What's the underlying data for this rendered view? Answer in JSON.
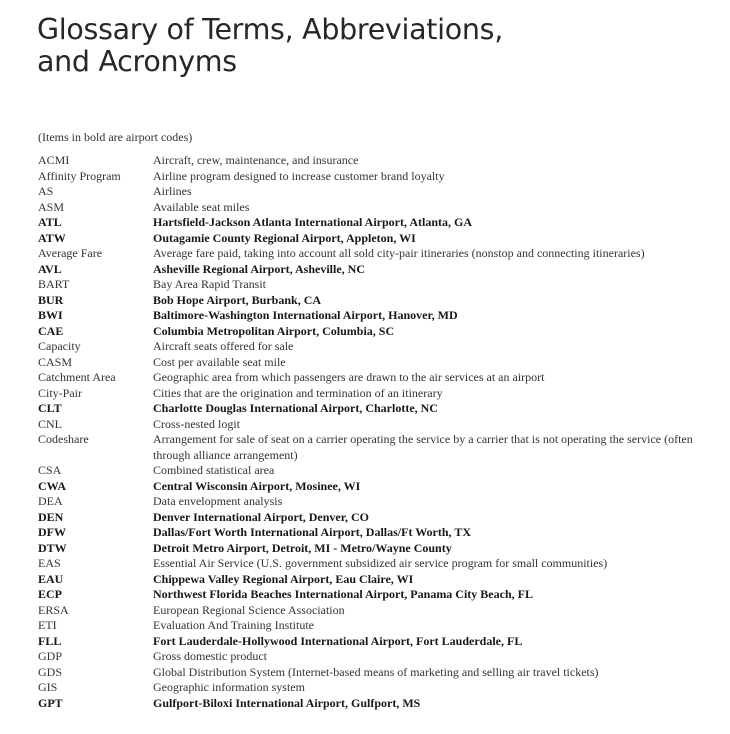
{
  "title_line1": "Glossary of Terms, Abbreviations,",
  "title_line2": "and Acronyms",
  "note": "(Items in bold are airport codes)",
  "entries": [
    {
      "term": "ACMI",
      "definition": "Aircraft, crew, maintenance, and insurance",
      "bold": false
    },
    {
      "term": "Affinity Program",
      "definition": "Airline program designed to increase customer brand loyalty",
      "bold": false
    },
    {
      "term": "AS",
      "definition": "Airlines",
      "bold": false
    },
    {
      "term": "ASM",
      "definition": "Available seat miles",
      "bold": false
    },
    {
      "term": "ATL",
      "definition": "Hartsfield-Jackson Atlanta International Airport, Atlanta, GA",
      "bold": true
    },
    {
      "term": "ATW",
      "definition": "Outagamie County Regional Airport, Appleton, WI",
      "bold": true
    },
    {
      "term": "Average Fare",
      "definition": "Average fare paid, taking into account all sold city-pair itineraries (nonstop and connecting itineraries)",
      "bold": false
    },
    {
      "term": "AVL",
      "definition": "Asheville Regional Airport, Asheville, NC",
      "bold": true
    },
    {
      "term": "BART",
      "definition": "Bay Area Rapid Transit",
      "bold": false
    },
    {
      "term": "BUR",
      "definition": "Bob Hope Airport, Burbank, CA",
      "bold": true
    },
    {
      "term": "BWI",
      "definition": "Baltimore-Washington International Airport, Hanover, MD",
      "bold": true
    },
    {
      "term": "CAE",
      "definition": "Columbia Metropolitan Airport, Columbia, SC",
      "bold": true
    },
    {
      "term": "Capacity",
      "definition": "Aircraft seats offered for sale",
      "bold": false
    },
    {
      "term": "CASM",
      "definition": "Cost per available seat mile",
      "bold": false
    },
    {
      "term": "Catchment Area",
      "definition": "Geographic area from which passengers are drawn to the air services at an airport",
      "bold": false
    },
    {
      "term": "City-Pair",
      "definition": "Cities that are the origination and termination of an itinerary",
      "bold": false
    },
    {
      "term": "CLT",
      "definition": "Charlotte Douglas International Airport, Charlotte, NC",
      "bold": true
    },
    {
      "term": "CNL",
      "definition": "Cross-nested logit",
      "bold": false
    },
    {
      "term": "Codeshare",
      "definition": "Arrangement for sale of seat on a carrier operating the service by a carrier that is not operating the service (often through alliance arrangement)",
      "bold": false
    },
    {
      "term": "CSA",
      "definition": "Combined statistical area",
      "bold": false
    },
    {
      "term": "CWA",
      "definition": "Central Wisconsin Airport, Mosinee, WI",
      "bold": true
    },
    {
      "term": "DEA",
      "definition": "Data envelopment analysis",
      "bold": false
    },
    {
      "term": "DEN",
      "definition": "Denver International Airport, Denver, CO",
      "bold": true
    },
    {
      "term": "DFW",
      "definition": "Dallas/Fort Worth International Airport, Dallas/Ft Worth, TX",
      "bold": true
    },
    {
      "term": "DTW",
      "definition": "Detroit Metro Airport, Detroit, MI - Metro/Wayne County",
      "bold": true
    },
    {
      "term": "EAS",
      "definition": "Essential Air Service (U.S. government subsidized air service program for small communities)",
      "bold": false
    },
    {
      "term": "EAU",
      "definition": "Chippewa Valley Regional Airport, Eau Claire, WI",
      "bold": true
    },
    {
      "term": "ECP",
      "definition": "Northwest Florida Beaches International Airport, Panama City Beach, FL",
      "bold": true
    },
    {
      "term": "ERSA",
      "definition": "European Regional Science Association",
      "bold": false
    },
    {
      "term": "ETI",
      "definition": "Evaluation And Training Institute",
      "bold": false
    },
    {
      "term": "FLL",
      "definition": "Fort Lauderdale-Hollywood International Airport, Fort Lauderdale, FL",
      "bold": true
    },
    {
      "term": "GDP",
      "definition": "Gross domestic product",
      "bold": false
    },
    {
      "term": "GDS",
      "definition": "Global Distribution System (Internet-based means of marketing and selling air travel tickets)",
      "bold": false
    },
    {
      "term": "GIS",
      "definition": "Geographic information system",
      "bold": false
    },
    {
      "term": "GPT",
      "definition": "Gulfport-Biloxi International Airport, Gulfport, MS",
      "bold": true
    }
  ]
}
